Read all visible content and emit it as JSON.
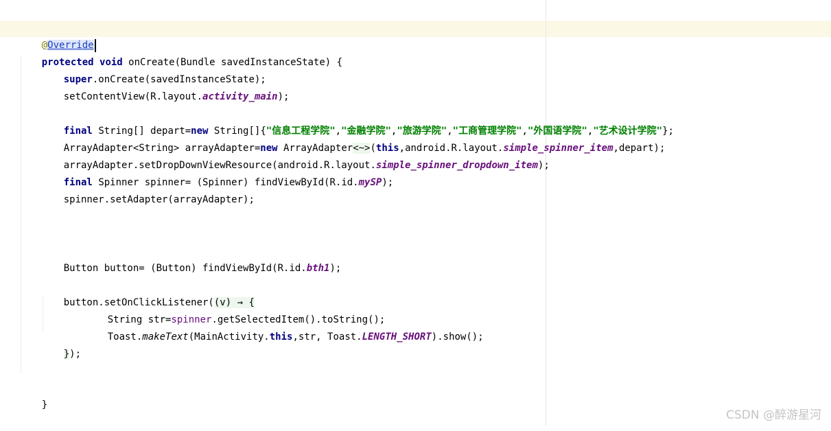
{
  "code": {
    "line1": {
      "at": "@",
      "annotation": "Override"
    },
    "line2": {
      "kw1": "protected",
      "kw2": "void",
      "rest": "onCreate(Bundle savedInstanceState) {"
    },
    "line3": {
      "kw": "super",
      "rest": ".onCreate(savedInstanceState);"
    },
    "line4": {
      "pre": "setContentView(R.layout.",
      "field": "activity_main",
      "post": ");"
    },
    "line5": {
      "kw1": "final",
      "mid1": "String[] depart=",
      "kw2": "new",
      "mid2": "String[]{",
      "strings": [
        "\"信息工程学院\"",
        "\"金融学院\"",
        "\"旅游学院\"",
        "\"工商管理学院\"",
        "\"外国语学院\"",
        "\"艺术设计学院\""
      ],
      "sep": ",",
      "end": "};"
    },
    "line6": {
      "pre": "ArrayAdapter<String> arrayAdapter=",
      "kw": "new",
      "mid": "ArrayAdapter",
      "diamond": "<~>",
      "open": "(",
      "kw2": "this",
      "mid2": ",android.R.layout.",
      "field": "simple_spinner_item",
      "post": ",depart);"
    },
    "line7": {
      "pre": "arrayAdapter.setDropDownViewResource(android.R.layout.",
      "field": "simple_spinner_dropdown_item",
      "post": ");"
    },
    "line8": {
      "kw": "final",
      "pre": "Spinner spinner= (Spinner) findViewById(R.id.",
      "field": "mySP",
      "post": ");"
    },
    "line9": {
      "text": "spinner.setAdapter(arrayAdapter);"
    },
    "line10": {
      "pre": "Button button= (Button) findViewById(R.id.",
      "field": "bth1",
      "post": ");"
    },
    "line11": {
      "pre": "button.setOnClickListener(",
      "lambda": "(v) → {"
    },
    "line12": {
      "pre": "String str=",
      "field": "spinner",
      "post": ".getSelectedItem().toString();"
    },
    "line13": {
      "pre": "Toast.",
      "method": "makeText",
      "mid": "(MainActivity.",
      "kw": "this",
      "mid2": ",str, Toast.",
      "field": "LENGTH_SHORT",
      "post": ").show();"
    },
    "line14": {
      "brace": "}",
      "post": ");"
    },
    "line15": {
      "text": "}"
    }
  },
  "watermark": "CSDN @醉游星河"
}
